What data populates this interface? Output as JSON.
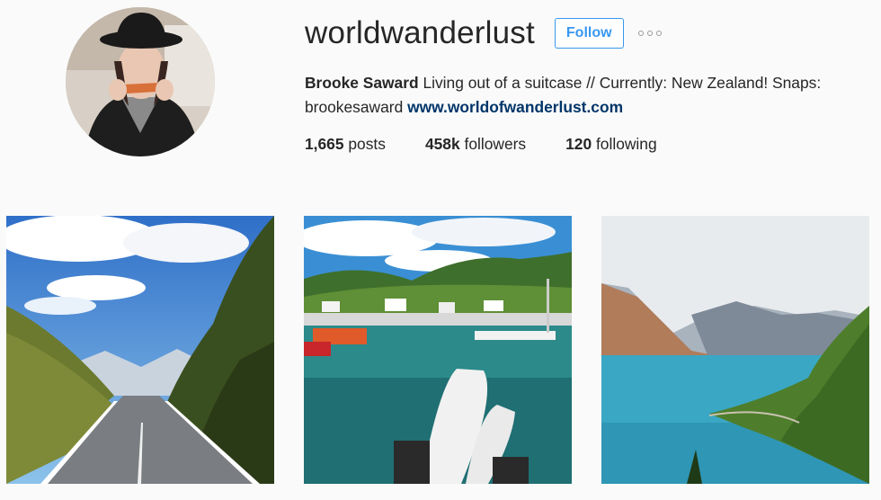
{
  "profile": {
    "username": "worldwanderlust",
    "follow_label": "Follow",
    "more_options_icon": "more-options-icon",
    "full_name": "Brooke Saward",
    "bio_text": "Living out of a suitcase // Currently: New Zealand! Snaps: brookesaward",
    "website": "www.worldofwanderlust.com",
    "avatar_icon": "profile-photo-avatar"
  },
  "stats": {
    "posts_count": "1,665",
    "posts_label": "posts",
    "followers_count": "458k",
    "followers_label": "followers",
    "following_count": "120",
    "following_label": "following"
  },
  "posts": [
    {
      "subject": "mountain road"
    },
    {
      "subject": "harbour with sneakers"
    },
    {
      "subject": "lake and mountains"
    }
  ],
  "colors": {
    "accent": "#3897f0",
    "link": "#003569",
    "text": "#262626",
    "background": "#fafafa"
  }
}
